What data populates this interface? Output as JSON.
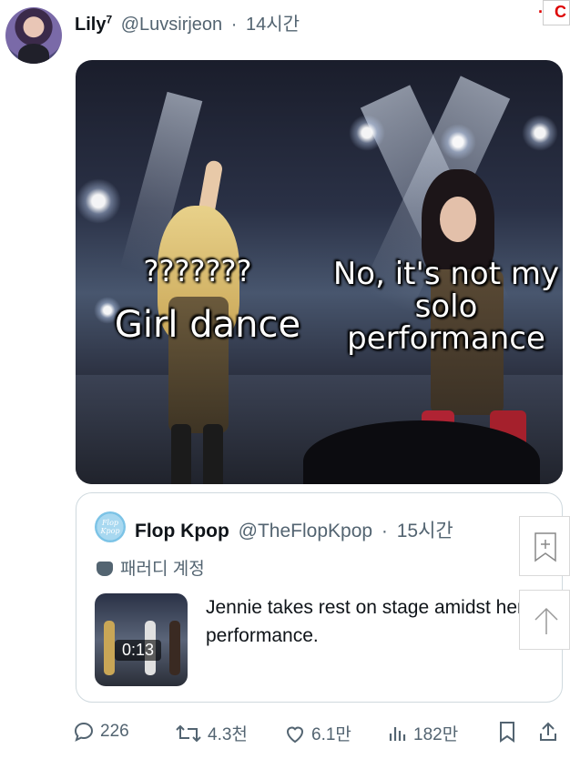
{
  "tweet": {
    "display_name": "Lily",
    "display_name_sup": "7",
    "handle": "@Luvsirjeon",
    "separator": "·",
    "time": "14시간"
  },
  "media": {
    "caption_left_top": "???????",
    "caption_left_bottom": "Girl dance",
    "caption_right": "No, it's not my solo performance"
  },
  "quoted": {
    "avatar_text": "Flop Kpop",
    "display_name": "Flop Kpop",
    "handle": "@TheFlopKpop",
    "separator": "·",
    "time": "15시간",
    "parody_label": "패러디 계정",
    "video_duration": "0:13",
    "text": "Jennie takes rest on stage amidst her performance."
  },
  "actions": {
    "replies": "226",
    "reposts": "4.3천",
    "likes": "6.1만",
    "views": "182만"
  },
  "icons": [
    "reply-icon",
    "repost-icon",
    "like-icon",
    "views-icon",
    "bookmark-icon",
    "share-icon",
    "parody-mask-icon",
    "side-bookmark-icon",
    "side-scroll-up-icon"
  ],
  "colors": {
    "text": "#0f1419",
    "secondary": "#536471",
    "border": "#cfd9de"
  }
}
